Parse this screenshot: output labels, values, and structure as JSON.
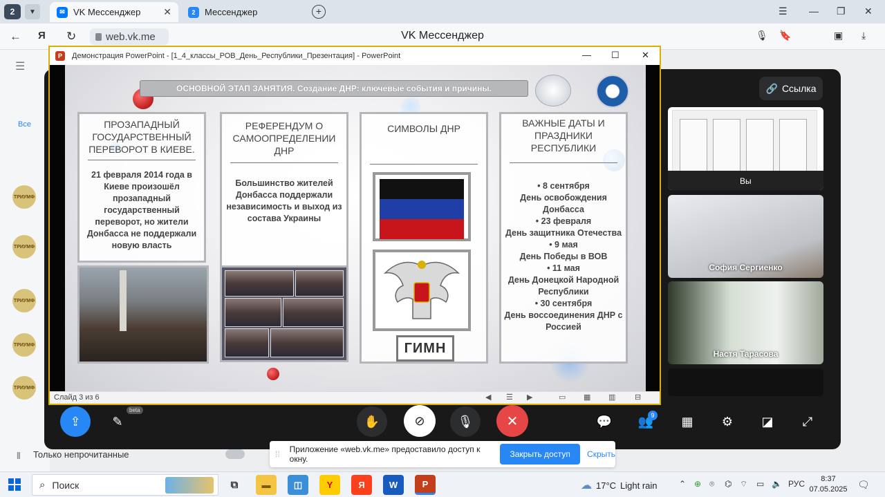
{
  "browser": {
    "tab_count": "2",
    "active_tab_title": "VK Мессенджер",
    "inactive_tab_badge": "2",
    "inactive_tab_title": "Мессенджер",
    "url": "web.vk.me",
    "page_title": "VK Мессенджер"
  },
  "vk": {
    "only_unread_label": "Только непрочитанные",
    "avatar_label": "ТРИУМФ",
    "filter_all": "Все"
  },
  "call": {
    "link_button": "Ссылка",
    "participants": [
      {
        "name": "Вы"
      },
      {
        "name": "София Сергиенко"
      },
      {
        "name": "Настя Тарасова"
      }
    ],
    "beta_label": "beta",
    "participants_count": "9"
  },
  "notice": {
    "message": "Приложение «web.vk.me» предоставило доступ к окну.",
    "stop_button": "Закрыть доступ",
    "hide_link": "Скрыть"
  },
  "ppt": {
    "window_title": "Демонстрация PowerPoint - [1_4_классы_РОВ_День_Республики_Презентация] - PowerPoint",
    "slide_status": "Слайд 3 из 6",
    "slide": {
      "header": "ОСНОВНОЙ ЭТАП ЗАНЯТИЯ. Создание ДНР: ключевые события и причины.",
      "col1_title": "ПРОЗАПАДНЫЙ ГОСУДАРСТВЕННЫЙ ПЕРЕВОРОТ В КИЕВЕ.",
      "col1_text": "21 февраля 2014 года в Киеве произошёл прозападный государственный переворот, но жители Донбасса не поддержали новую власть",
      "col2_title": "РЕФЕРЕНДУМ О САМООПРЕДЕЛЕНИИ ДНР",
      "col2_text": "Большинство жителей Донбасса поддержали независимость и выход из состава Украины",
      "col3_title": "СИМВОЛЫ ДНР",
      "col3_anthem": "ГИМН",
      "col4_title": "ВАЖНЫЕ ДАТЫ И ПРАЗДНИКИ РЕСПУБЛИКИ",
      "col4_items": [
        "• 8 сентября",
        "День освобождения Донбасса",
        "• 23 февраля",
        "День защитника Отечества",
        "• 9 мая",
        "День Победы в ВОВ",
        "• 11 мая",
        "День Донецкой Народной Республики",
        "• 30 сентября",
        "День воссоединения ДНР с Россией"
      ]
    }
  },
  "taskbar": {
    "search_label": "Поиск",
    "weather_temp": "17°C",
    "weather_text": "Light rain",
    "lang": "РУС",
    "time": "8:37",
    "date": "07.05.2025"
  },
  "colors": {
    "accent": "#2787f5",
    "call_bg": "#19191a",
    "end_call": "#e64646",
    "ppt_border": "#d9b000",
    "flag_black": "#111111",
    "flag_blue": "#1f3fa6",
    "flag_red": "#c8151b"
  }
}
